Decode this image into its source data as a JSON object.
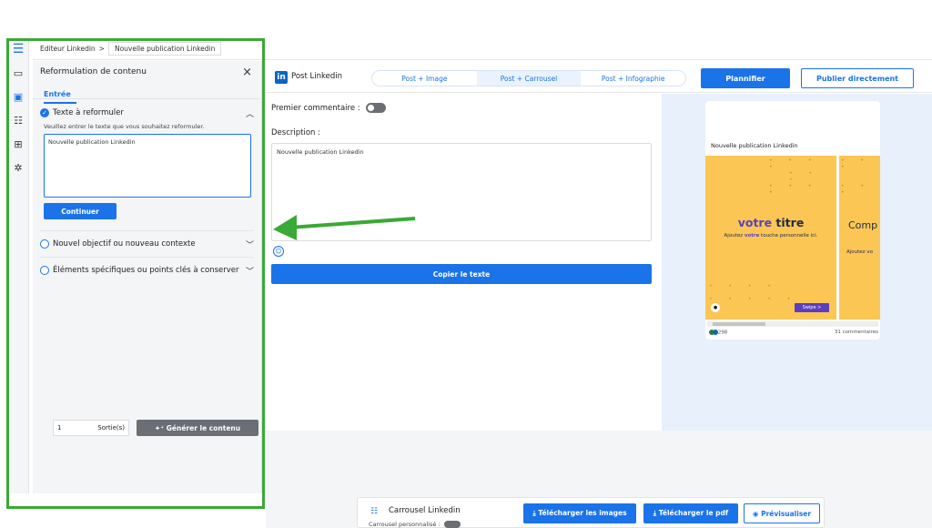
{
  "breadcrumb": {
    "root": "Editeur Linkedin",
    "separator": ">",
    "current": "Nouvelle publication Linkedin"
  },
  "panel": {
    "title": "Reformulation de contenu",
    "close_icon": "×",
    "tab": "Entrée",
    "sections": [
      {
        "title": "Texte à reformuler",
        "help": "Veuillez entrer le texte que vous souhaitez reformuler.",
        "value": "Nouvelle publication Linkedin",
        "button": "Continuer"
      },
      {
        "title": "Nouvel objectif ou nouveau contexte"
      },
      {
        "title": "Éléments spécifiques ou points clés à conserver"
      }
    ],
    "quantity": "1",
    "quantity_unit": "Sortie(s)",
    "generate_button": "Générer le contenu"
  },
  "header": {
    "post_title": "Post Linkedin",
    "tabs": [
      "Post + Image",
      "Post + Carrousel",
      "Post + Infographie"
    ],
    "active_tab": "Post + Carrousel",
    "plan_button": "Plannifier",
    "publish_button": "Publier directement"
  },
  "editor": {
    "comment_label": "Premier commentaire :",
    "description_label": "Description :",
    "description_value": "Nouvelle publication Linkedin",
    "copy_button": "Copier le texte"
  },
  "preview": {
    "post_text": "Nouvelle publication Linkedin",
    "slide_title_accent": "votre",
    "slide_title_rest": " titre",
    "slide_sub_a": "Ajoutez ",
    "slide_sub_accent": "votre",
    "slide_sub_b": " touche personnelle ici.",
    "slide2_title": "Comp",
    "slide2_sub": "Ajoutez vo",
    "swipe_label": "Swipe  >",
    "reactions": "298",
    "comments": "31 commentaires"
  },
  "bottom": {
    "carousel_title": "Carrousel Linkedin",
    "carousel_sub": "Carrousel personnalisé :",
    "download_images": "Télécharger les images",
    "download_pdf": "Télécharger le pdf",
    "preview_button": "Prévisualiser"
  },
  "colors": {
    "accent": "#1a73e8",
    "highlight": "#3aa935",
    "slide": "#fcc654"
  }
}
